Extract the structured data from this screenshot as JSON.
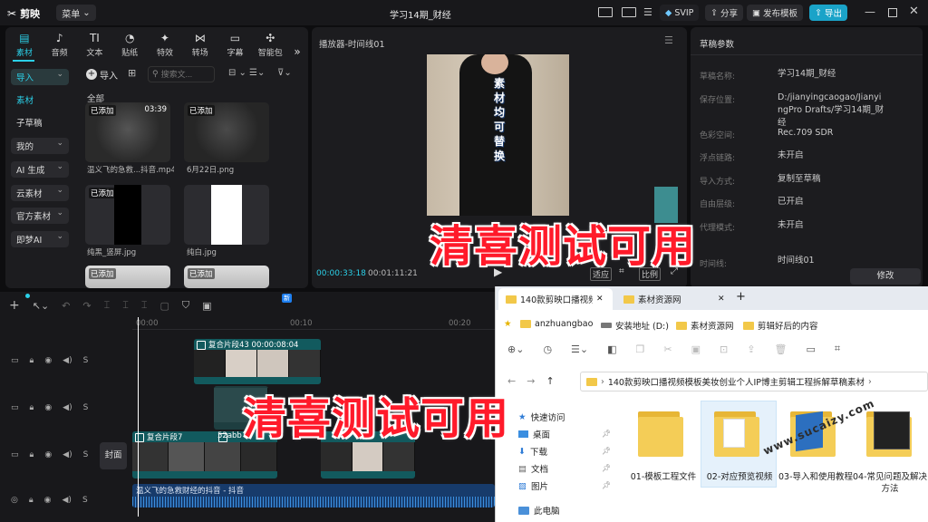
{
  "app": {
    "name": "剪映",
    "menu_label": "菜单",
    "title": "学习14期_财经"
  },
  "toolbar": {
    "svip": "SVIP",
    "share": "分享",
    "publish": "发布模板",
    "export": "导出"
  },
  "categories": [
    {
      "label": "素材",
      "icon": "media-icon"
    },
    {
      "label": "音频",
      "icon": "audio-icon"
    },
    {
      "label": "文本",
      "icon": "text-icon"
    },
    {
      "label": "贴纸",
      "icon": "sticker-icon"
    },
    {
      "label": "特效",
      "icon": "effects-icon"
    },
    {
      "label": "转场",
      "icon": "transition-icon"
    },
    {
      "label": "字幕",
      "icon": "caption-icon"
    },
    {
      "label": "智能包",
      "icon": "smart-pack-icon"
    }
  ],
  "sidebar": {
    "items": [
      "导入",
      "素材",
      "子草稿",
      "我的",
      "AI 生成",
      "云素材",
      "官方素材",
      "即梦AI"
    ]
  },
  "media": {
    "import_label": "导入",
    "search_placeholder": "搜索文...",
    "group_label": "全部",
    "added_tag": "已添加",
    "cards": [
      {
        "caption": "温义飞的急救...抖音.mp4",
        "duration": "03:39"
      },
      {
        "caption": "6月22日.png",
        "duration": ""
      },
      {
        "caption": "纯黑_竖屏.jpg",
        "duration": ""
      },
      {
        "caption": "纯白.jpg",
        "duration": ""
      }
    ]
  },
  "player": {
    "title": "播放器-时间线01",
    "current_time": "00:00:33:18",
    "total_time": "00:01:11:21",
    "video_text": "素材均可替换",
    "btn_fit": "适应",
    "btn_ratio": "比例"
  },
  "draft": {
    "title": "草稿参数",
    "rows": [
      {
        "label": "草稿名称:",
        "value": "学习14期_财经"
      },
      {
        "label": "保存位置:",
        "value": "D:/jianyingcaogao/JianyingPro Drafts/学习14期_财经"
      },
      {
        "label": "色彩空间:",
        "value": "Rec.709 SDR"
      },
      {
        "label": "浮点链路:",
        "value": "未开启"
      },
      {
        "label": "导入方式:",
        "value": "复制至草稿"
      },
      {
        "label": "自由层级:",
        "value": "已开启"
      },
      {
        "label": "代理模式:",
        "value": "未开启"
      },
      {
        "label": "时间线:",
        "value": "时间线01"
      }
    ],
    "edit_label": "修改"
  },
  "timeline": {
    "ticks": [
      "00:00",
      "00:10",
      "00:20"
    ],
    "new_badge": "新",
    "cover_label": "封面",
    "clips": [
      {
        "name": "复合片段43",
        "time": "00:00:08:04"
      },
      {
        "name": "复合片段7",
        "time": "00:00:03:22"
      },
      {
        "name": "52abb",
        "time": ""
      }
    ],
    "audio_label": "温义飞的急救财经的抖音 - 抖音"
  },
  "overlay_text": "清喜测试可用",
  "explorer": {
    "tabs": [
      "140款剪映口播视频",
      "素材资源网"
    ],
    "quick": [
      "anzhuangbao",
      "安装地址 (D:)",
      "素材资源网",
      "剪辑好后的内容"
    ],
    "path": "140款剪映口播视频模板美妆创业个人IP博主剪辑工程拆解草稿素材",
    "nav": [
      "快速访问",
      "桌面",
      "下载",
      "文档",
      "图片",
      "此电脑"
    ],
    "folders": [
      "01-模板工程文件",
      "02-对应预览视频",
      "03-导入和使用教程",
      "04-常见问题及解决方法"
    ],
    "watermark": "www.sucaizy.com"
  },
  "colors": {
    "accent": "#2bd0e8",
    "overlay": "#ff1a2a",
    "clip": "#125a5e",
    "export": "#1aa3c8"
  }
}
